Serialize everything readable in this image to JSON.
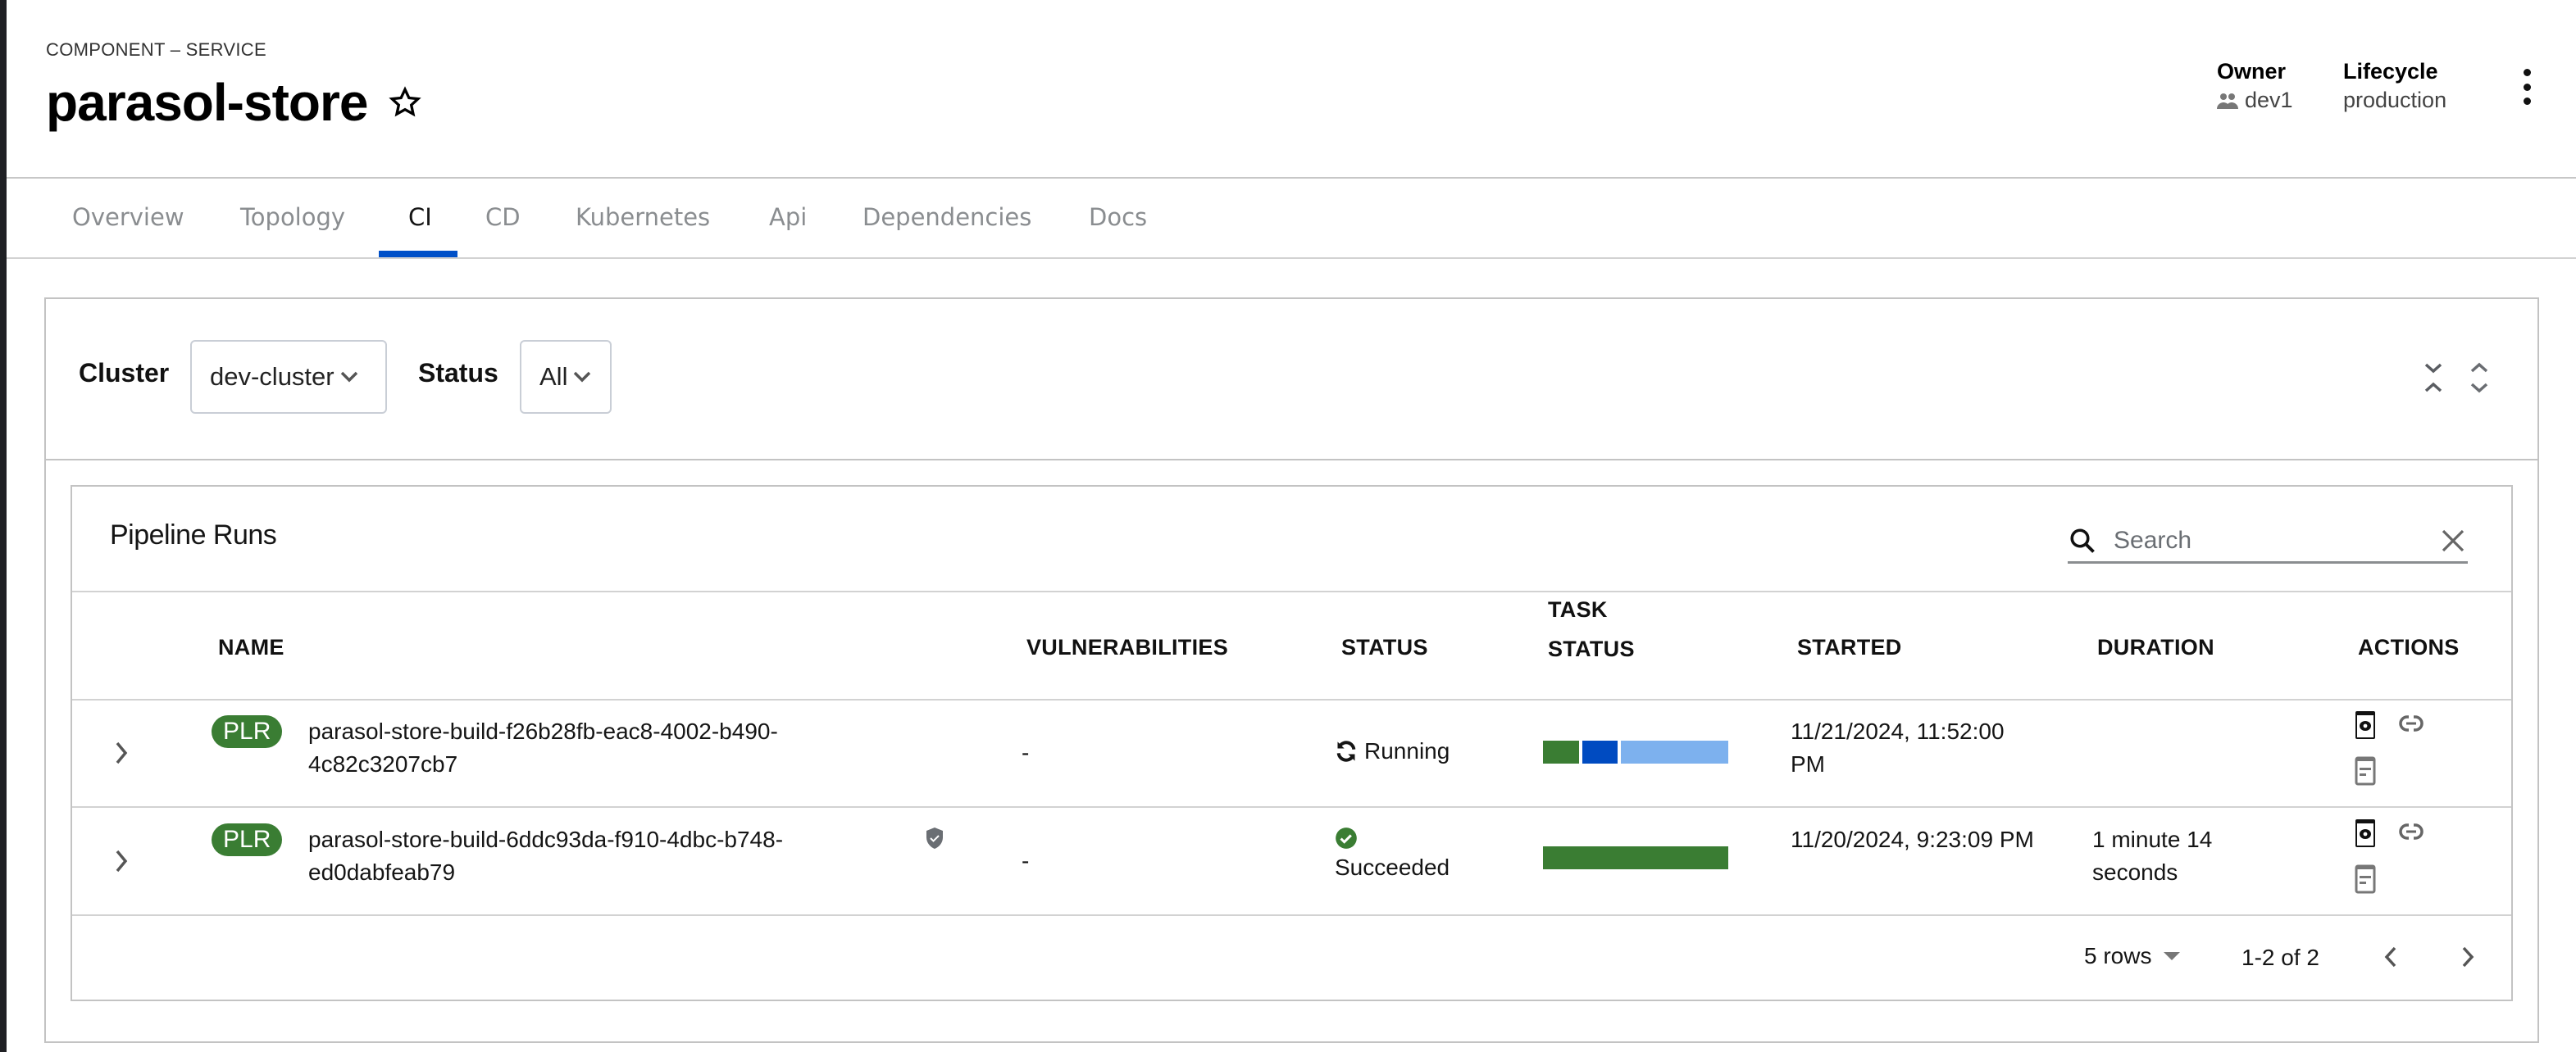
{
  "header": {
    "kind": "COMPONENT – SERVICE",
    "title": "parasol-store",
    "owner_label": "Owner",
    "owner_value": "dev1",
    "lifecycle_label": "Lifecycle",
    "lifecycle_value": "production"
  },
  "tabs": [
    {
      "label": "Overview",
      "active": false
    },
    {
      "label": "Topology",
      "active": false
    },
    {
      "label": "CI",
      "active": true
    },
    {
      "label": "CD",
      "active": false
    },
    {
      "label": "Kubernetes",
      "active": false
    },
    {
      "label": "Api",
      "active": false
    },
    {
      "label": "Dependencies",
      "active": false
    },
    {
      "label": "Docs",
      "active": false
    }
  ],
  "filters": {
    "cluster_label": "Cluster",
    "cluster_value": "dev-cluster",
    "status_label": "Status",
    "status_value": "All"
  },
  "pipeline_runs": {
    "title": "Pipeline Runs",
    "search_placeholder": "Search",
    "columns": [
      "NAME",
      "VULNERABILITIES",
      "STATUS",
      "TASK",
      "STATUS",
      "STARTED",
      "DURATION",
      "ACTIONS"
    ],
    "column_labels": {
      "name": "NAME",
      "vulnerabilities": "VULNERABILITIES",
      "status": "STATUS",
      "task_status_line1": "TASK",
      "task_status_line2": "STATUS",
      "started": "STARTED",
      "duration": "DURATION",
      "actions": "ACTIONS"
    },
    "rows": [
      {
        "badge": "PLR",
        "name": "parasol-store-build-f26b28fb-eac8-4002-b490-4c82c3207cb7",
        "signed": false,
        "vulnerabilities": "-",
        "status": "Running",
        "task_status": {
          "succeeded": 1,
          "running": 1,
          "pending": 3
        },
        "started": "11/21/2024, 11:52:00 PM",
        "duration": ""
      },
      {
        "badge": "PLR",
        "name": "parasol-store-build-6ddc93da-f910-4dbc-b748-ed0dabfeab79",
        "signed": true,
        "vulnerabilities": "-",
        "status": "Succeeded",
        "task_status": {
          "succeeded": 1,
          "running": 0,
          "pending": 0
        },
        "started": "11/20/2024, 9:23:09 PM",
        "duration": "1 minute 14 seconds"
      }
    ],
    "pagination": {
      "per_page": "5 rows",
      "range": "1-2 of 2"
    }
  },
  "colors": {
    "accent": "#0050c8",
    "success": "#3a7d33",
    "running": "#004bc1",
    "pending": "#7db1ee"
  }
}
